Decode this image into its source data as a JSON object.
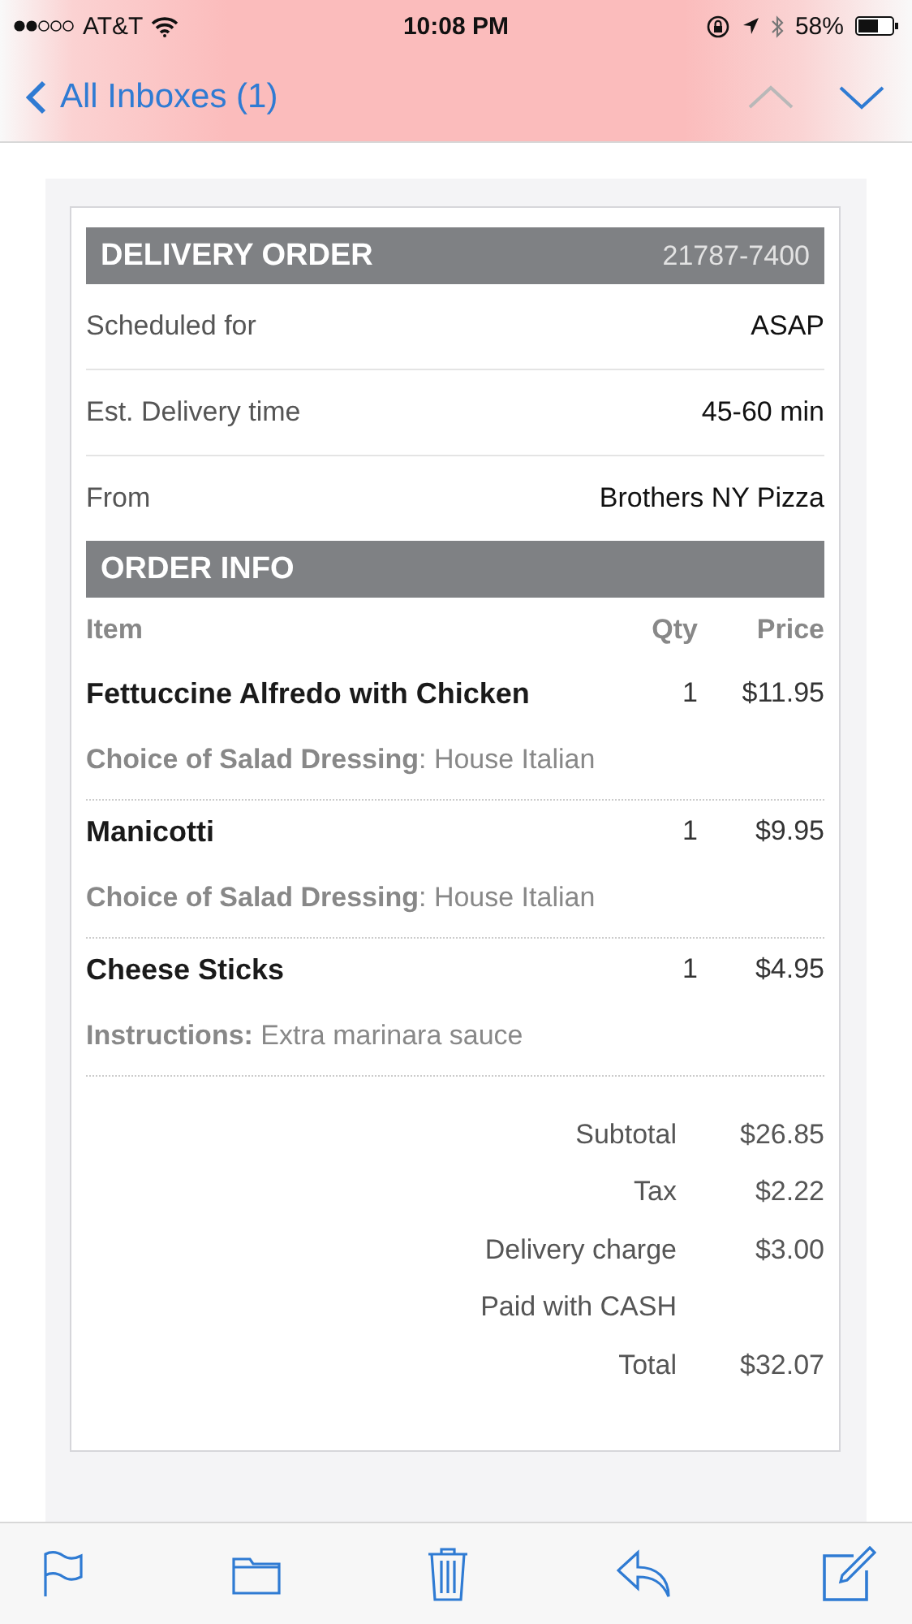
{
  "status_bar": {
    "carrier": "AT&T",
    "time": "10:08 PM",
    "battery": "58%"
  },
  "nav": {
    "back_label": "All Inboxes (1)",
    "previous_disabled": true,
    "next_disabled": false
  },
  "order": {
    "title": "DELIVERY ORDER",
    "number": "21787-7400",
    "details": [
      {
        "label": "Scheduled for",
        "value": "ASAP"
      },
      {
        "label": "Est. Delivery time",
        "value": "45-60 min"
      },
      {
        "label": "From",
        "value": "Brothers NY Pizza"
      }
    ],
    "info_title": "ORDER INFO",
    "columns": [
      "Item",
      "Qty",
      "Price"
    ],
    "items": [
      {
        "name": "Fettuccine Alfredo with Chicken",
        "qty": "1",
        "price": "$11.95",
        "note": "**Choice of Salad Dressing**: House Italian"
      },
      {
        "name": "Manicotti",
        "qty": "1",
        "price": "$9.95",
        "note": "**Choice of Salad Dressing**: House Italian"
      },
      {
        "name": "Cheese Sticks",
        "qty": "1",
        "price": "$4.95",
        "note": "**Instructions:** Extra marinara sauce"
      }
    ],
    "totals": [
      {
        "label": "Subtotal",
        "value": "$26.85"
      },
      {
        "label": "Tax",
        "value": "$2.22"
      },
      {
        "label": "Delivery charge",
        "value": "$3.00"
      },
      {
        "label": "Paid with CASH"
      },
      {
        "label": "Total",
        "value": "$32.07"
      }
    ]
  }
}
